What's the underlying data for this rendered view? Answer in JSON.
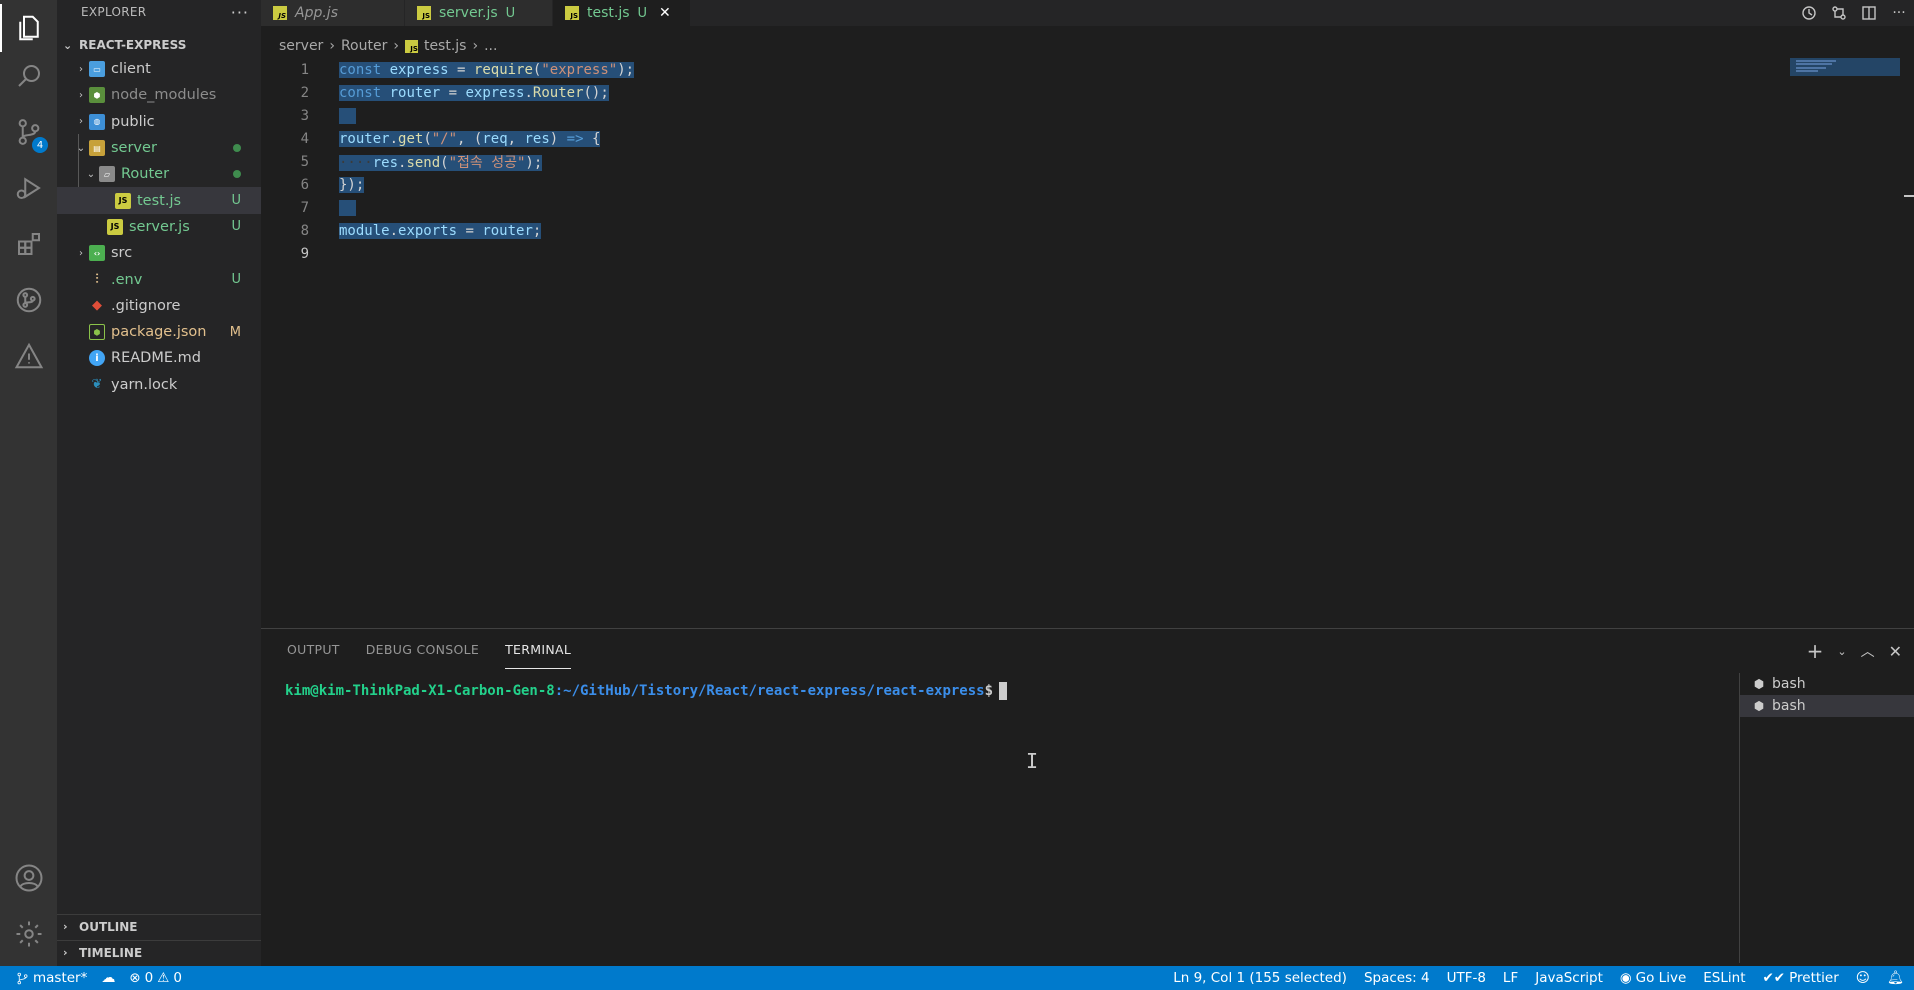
{
  "sidebar": {
    "title": "EXPLORER",
    "more": "···",
    "root_folder": "REACT-EXPRESS",
    "items": [
      {
        "label": "client"
      },
      {
        "label": "node_modules"
      },
      {
        "label": "public"
      },
      {
        "label": "server"
      },
      {
        "label": "Router"
      },
      {
        "label": "test.js",
        "badge": "U"
      },
      {
        "label": "server.js",
        "badge": "U"
      },
      {
        "label": "src"
      },
      {
        "label": ".env",
        "badge": "U"
      },
      {
        "label": ".gitignore"
      },
      {
        "label": "package.json",
        "badge": "M"
      },
      {
        "label": "README.md"
      },
      {
        "label": "yarn.lock"
      }
    ],
    "outline": "OUTLINE",
    "timeline": "TIMELINE"
  },
  "activity": {
    "scm_badge": "4",
    "icons": [
      "explorer-icon",
      "search-icon",
      "source-control-icon",
      "run-debug-icon",
      "extensions-icon",
      "git-graph-icon",
      "problems-icon",
      "account-icon",
      "settings-gear-icon"
    ]
  },
  "tabs": [
    {
      "label": "App.js"
    },
    {
      "label": "server.js",
      "badge": "U"
    },
    {
      "label": "test.js",
      "badge": "U",
      "close": "✕"
    }
  ],
  "breadcrumb": {
    "parts": [
      "server",
      "Router",
      "test.js",
      "..."
    ]
  },
  "editor": {
    "line_numbers": [
      "1",
      "2",
      "3",
      "4",
      "5",
      "6",
      "7",
      "8",
      "9"
    ]
  },
  "panel": {
    "tabs": [
      "OUTPUT",
      "DEBUG CONSOLE",
      "TERMINAL"
    ],
    "prompt_user": "kim@kim-ThinkPad-X1-Carbon-Gen-8",
    "prompt_path": ":~/GitHub/Tistory/React/react-express/react-express",
    "prompt_dollar": "$",
    "terminals": [
      "bash",
      "bash"
    ]
  },
  "status": {
    "branch": "master*",
    "errors": "0",
    "warnings": "0",
    "cursor": "Ln 9, Col 1 (155 selected)",
    "spaces": "Spaces: 4",
    "encoding": "UTF-8",
    "eol": "LF",
    "language": "JavaScript",
    "golive": "Go Live",
    "eslint": "ESLint",
    "prettier": "Prettier"
  },
  "colors": {
    "accent": "#007acc",
    "untracked": "#73c991",
    "modified": "#e2c08d"
  }
}
